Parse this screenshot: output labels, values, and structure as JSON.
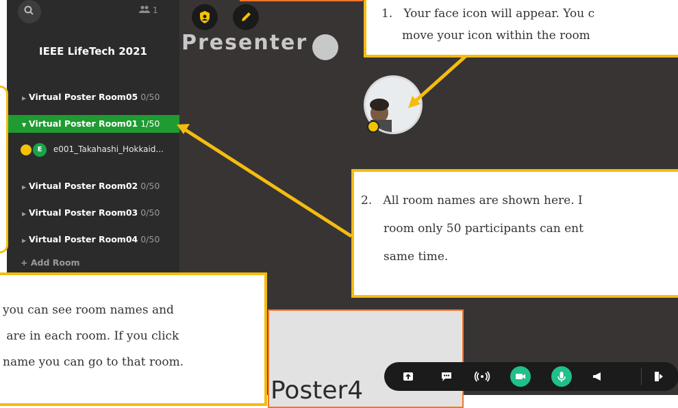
{
  "sidebar": {
    "participant_count": "1",
    "event_title": "IEEE LifeTech 2021",
    "rooms": [
      {
        "name": "Virtual Poster Room05",
        "count": "0/50"
      },
      {
        "name": "Virtual Poster Room01",
        "count": "1/50"
      },
      {
        "name": "Virtual Poster Room02",
        "count": "0/50"
      },
      {
        "name": "Virtual Poster Room03",
        "count": "0/50"
      },
      {
        "name": "Virtual Poster Room04",
        "count": "0/50"
      }
    ],
    "member": {
      "initial": "E",
      "name": "e001_Takahashi_Hokkaid..."
    },
    "add_room": "+ Add Room"
  },
  "canvas": {
    "presenter_label": "Presenter",
    "poster_text": "Poster4"
  },
  "callouts": {
    "one_line1": "1.   Your face icon will appear. You c",
    "one_line2": "move your icon within the room",
    "two_line1": "2.   All room names are shown here. I",
    "two_line2": "room only 50 participants can ent",
    "two_line3": "same time.",
    "three_line1": "you can see room names and",
    "three_line2": " are in each room. If you click",
    "three_line3": "name you can go to that room."
  },
  "colors": {
    "accent_green": "#1f9b31",
    "callout_border": "#f4bc0f",
    "canvas_bg": "#383434",
    "sidebar_bg": "#2b2b2b"
  },
  "icons": [
    "search-icon",
    "people-icon",
    "shield-icon",
    "pencil-icon",
    "share-screen-icon",
    "chat-icon",
    "broadcast-icon",
    "camera-icon",
    "microphone-icon",
    "megaphone-icon",
    "exit-icon"
  ]
}
